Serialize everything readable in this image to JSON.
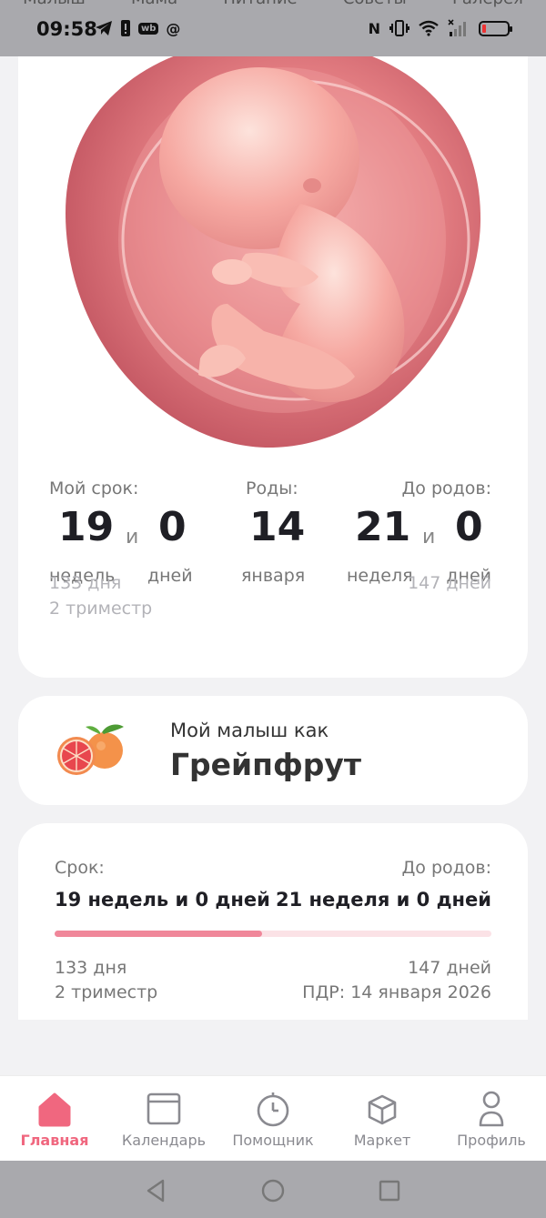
{
  "statusbar": {
    "time": "09:58",
    "ghost_tabs": [
      "Малыш",
      "Мама",
      "Питание",
      "Советы",
      "Галерея"
    ],
    "icons": [
      "telegram-icon",
      "notification-icon",
      "wb-icon",
      "at-icon",
      "nfc-icon",
      "vibrate-icon",
      "wifi-icon",
      "signal-icon",
      "battery-icon"
    ],
    "wb": "wb",
    "at": "@",
    "nfc": "N"
  },
  "stats": {
    "term_label": "Мой срок:",
    "term_weeks": "19",
    "term_and": "и",
    "term_days": "0",
    "term_weeks_unit": "недель",
    "term_days_unit": "дней",
    "birth_label": "Роды:",
    "birth_day": "14",
    "birth_month": "января",
    "left_label": "До родов:",
    "left_weeks": "21",
    "left_and": "и",
    "left_days": "0",
    "left_weeks_unit": "неделя",
    "left_days_unit": "дней",
    "days_passed": "133 дня",
    "trimester": "2 триместр",
    "days_left": "147 дней"
  },
  "fruit": {
    "subtitle": "Мой малыш как",
    "name": "Грейпфрут"
  },
  "progress": {
    "term_label": "Срок:",
    "term_value": "19 недель и 0 дней",
    "left_label": "До родов:",
    "left_value": "21 неделя и 0 дней",
    "fraction": 0.475,
    "days_passed": "133 дня",
    "trimester": "2 триместр",
    "days_left": "147 дней",
    "due_date": "ПДР: 14 января 2026"
  },
  "nav": [
    {
      "label": "Главная",
      "icon": "home-icon",
      "active": true
    },
    {
      "label": "Календарь",
      "icon": "calendar-icon",
      "active": false
    },
    {
      "label": "Помощник",
      "icon": "timer-icon",
      "active": false
    },
    {
      "label": "Маркет",
      "icon": "box-icon",
      "active": false
    },
    {
      "label": "Профиль",
      "icon": "profile-icon",
      "active": false
    }
  ],
  "colors": {
    "accent": "#f0677f",
    "progress_fill": "#f0879a",
    "progress_track": "#fbe2e6"
  }
}
